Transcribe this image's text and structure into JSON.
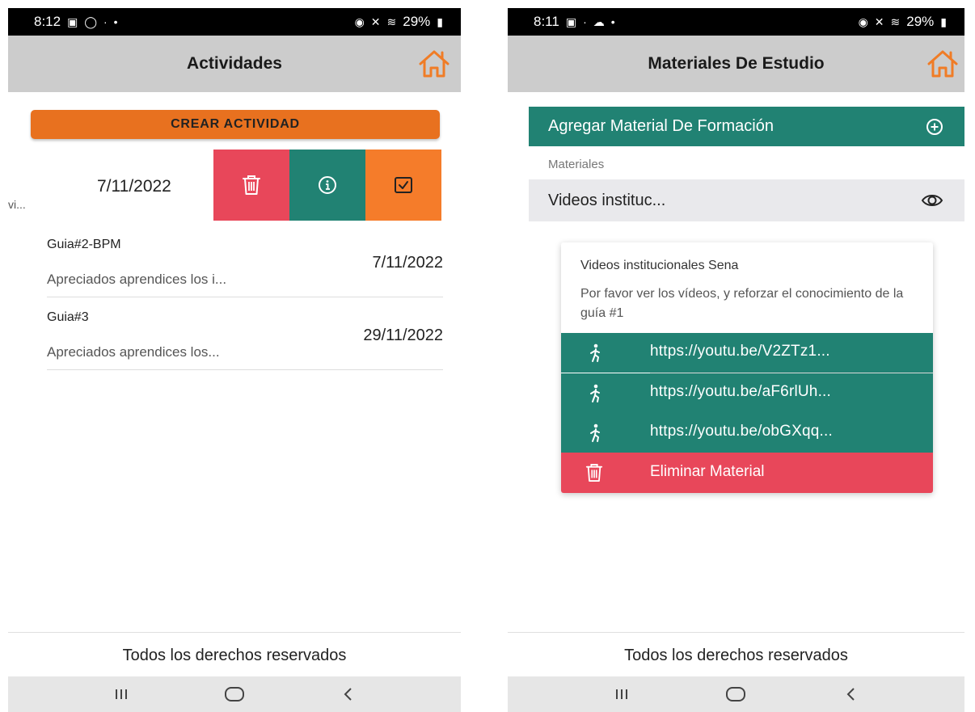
{
  "left_screen": {
    "status_bar": {
      "time": "8:12",
      "battery": "29%"
    },
    "app_bar": {
      "title": "Actividades"
    },
    "create_button": "CREAR ACTIVIDAD",
    "swiped_item": {
      "date": "7/11/2022",
      "truncated_text": "vi..."
    },
    "items": [
      {
        "name": "Guia#2-BPM",
        "description": "Apreciados aprendices los i...",
        "date": "7/11/2022"
      },
      {
        "name": "Guia#3",
        "description": "Apreciados aprendices los...",
        "date": "29/11/2022"
      }
    ],
    "footer": "Todos los derechos reservados"
  },
  "right_screen": {
    "status_bar": {
      "time": "8:11",
      "battery": "29%"
    },
    "app_bar": {
      "title": "Materiales De Estudio"
    },
    "add_material": "Agregar Material De Formación",
    "section_label": "Materiales",
    "material_item": "Videos instituc...",
    "popup": {
      "title": "Videos institucionales Sena",
      "message": "Por favor ver los vídeos, y reforzar el conocimiento de la guía #1",
      "links": [
        "https://youtu.be/V2ZTz1...",
        "https://youtu.be/aF6rlUh...",
        "https://youtu.be/obGXqq..."
      ],
      "delete_label": "Eliminar Material"
    },
    "footer": "Todos los derechos reservados"
  },
  "colors": {
    "accent_orange": "#e8711f",
    "teal": "#218273",
    "danger_red": "#e8475a",
    "appbar_gray": "#cccccc"
  },
  "icons": [
    "home-icon",
    "trash-icon",
    "info-icon",
    "check-square-icon",
    "plus-circle-icon",
    "eye-icon",
    "walking-person-icon"
  ]
}
